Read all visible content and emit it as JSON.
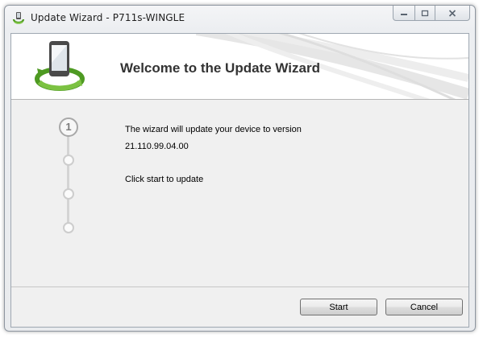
{
  "window": {
    "title": "Update Wizard - P711s-WINGLE",
    "controls": {
      "minimize_icon": "minimize-icon",
      "maximize_icon": "maximize-icon",
      "close_icon": "close-icon"
    }
  },
  "header": {
    "title": "Welcome to the Update Wizard",
    "icon": "phone-sync-icon"
  },
  "steps": {
    "current": "1",
    "total": 4
  },
  "body": {
    "intro": "The wizard will update your device to version",
    "version": "21.110.99.04.00",
    "instruction": "Click start to update"
  },
  "buttons": {
    "start": "Start",
    "cancel": "Cancel"
  },
  "colors": {
    "accent_green": "#5aa82a",
    "title_text": "#333333"
  }
}
